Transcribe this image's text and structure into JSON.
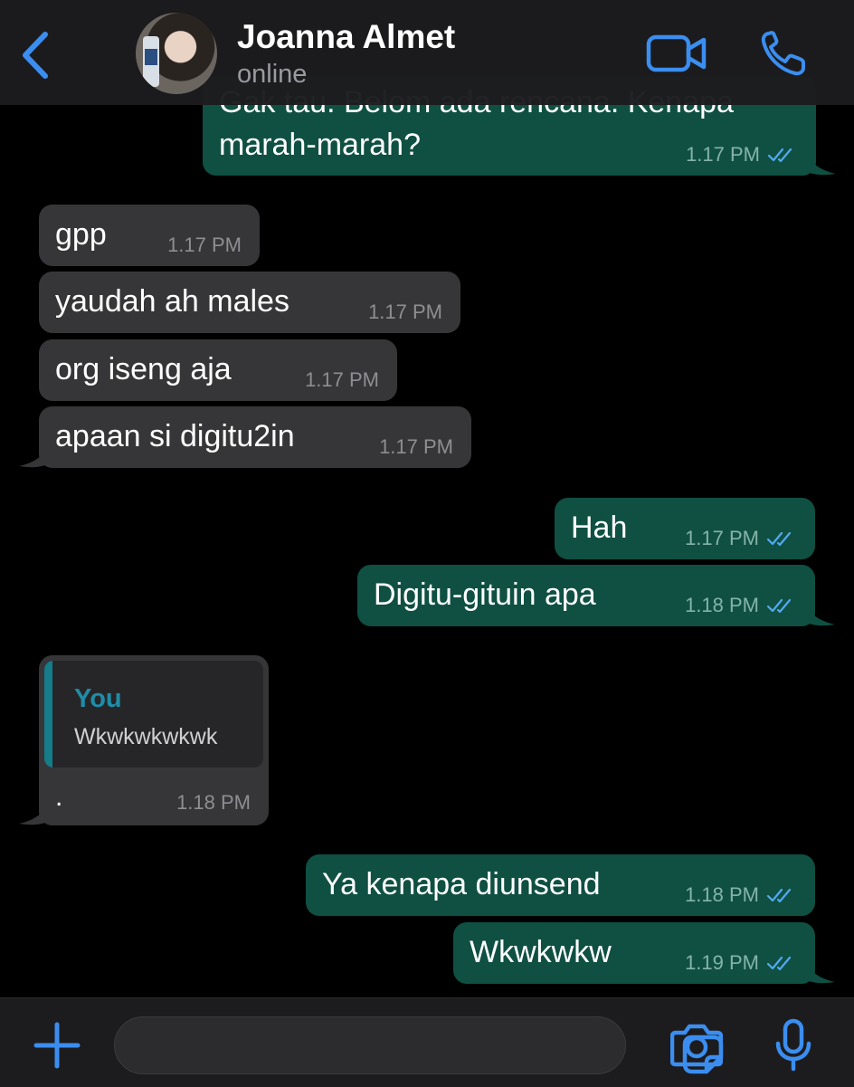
{
  "header": {
    "contact_name": "Joanna Almet",
    "status": "online"
  },
  "colors": {
    "accent": "#3b8ef0",
    "incoming_bubble": "#363638",
    "outgoing_bubble": "#0f5043",
    "read_ticks": "#53a9f0"
  },
  "messages": {
    "m0": {
      "text_line1": "Gak tau. Belom ada rencana. Kenapa",
      "text_line2": "marah-marah?",
      "time": "1.17 PM",
      "direction": "outgoing",
      "status": "read"
    },
    "m1": {
      "text": "gpp",
      "time": "1.17 PM",
      "direction": "incoming"
    },
    "m2": {
      "text": "yaudah ah males",
      "time": "1.17 PM",
      "direction": "incoming"
    },
    "m3": {
      "text": "org iseng aja",
      "time": "1.17 PM",
      "direction": "incoming"
    },
    "m4": {
      "text": "apaan si digitu2in",
      "time": "1.17 PM",
      "direction": "incoming"
    },
    "m5": {
      "text": "Hah",
      "time": "1.17 PM",
      "direction": "outgoing",
      "status": "read"
    },
    "m6": {
      "text": "Digitu-gituin apa",
      "time": "1.18 PM",
      "direction": "outgoing",
      "status": "read"
    },
    "m7": {
      "quote_author": "You",
      "quote_text": "Wkwkwkwkwk",
      "text": ".",
      "time": "1.18 PM",
      "direction": "incoming"
    },
    "m8": {
      "text": "Ya kenapa diunsend",
      "time": "1.18 PM",
      "direction": "outgoing",
      "status": "read"
    },
    "m9": {
      "text": "Wkwkwkw",
      "time": "1.19 PM",
      "direction": "outgoing",
      "status": "read"
    }
  },
  "input": {
    "placeholder": "",
    "value": ""
  },
  "icons": {
    "back": "chevron-left-icon",
    "video": "video-camera-icon",
    "call": "phone-icon",
    "attach": "plus-icon",
    "sticker": "sticker-icon",
    "camera": "camera-icon",
    "mic": "microphone-icon"
  }
}
